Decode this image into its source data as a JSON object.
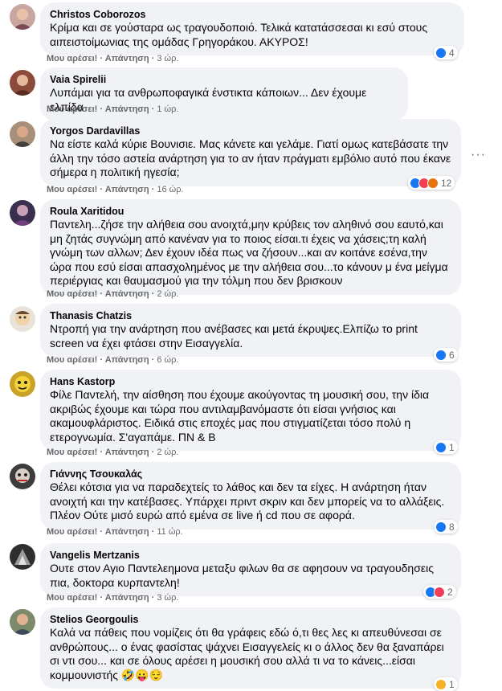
{
  "ui": {
    "like": "Μου αρέσει!",
    "reply": "Απάντηση",
    "dot": "·"
  },
  "colors": {
    "bubble": "#f0f2f5",
    "meta": "#65676b",
    "like_blue": "#1877f2",
    "heart_red": "#f33e58",
    "haha_yellow": "#f7b125"
  },
  "comments": [
    {
      "author": "Christos Coborozos",
      "text": "Κρίμα και σε γούσταρα ως τραγουδοποιό. Τελικά κατατάσσεσαι κι εσύ στους αιπειστοίμωνιας της ομάδας Γρηγοράκου. ΑΚΥΡΟΣ!",
      "time": "3 ώρ.",
      "reactions": [
        "like"
      ],
      "count": "4"
    },
    {
      "author": "Vaia Spirelii",
      "text": "Λυπάμαι για τα ανθρωποφαγικά ένστικτα κάποιων... Δεν έχουμε ελπίδα",
      "time": "1 ώρ.",
      "reactions": [],
      "count": ""
    },
    {
      "author": "Yorgos Dardavillas",
      "text": "Να είστε καλά κύριε Βουνισιε. Μας κάνετε και γελάμε. Γιατί ομως κατεβάσατε την άλλη την τόσο αστεία ανάρτηση για το αν ήταν πράγματι εμβόλιο αυτό που έκανε σήμερα η πολιτική ηγεσία;",
      "time": "16 ώρ.",
      "reactions": [
        "like",
        "love",
        "angry"
      ],
      "count": "12"
    },
    {
      "author": "Roula Xaritidou",
      "text": "Παντελη...ζήσε την αλήθεια σου ανοιχτά,μην κρύβεις τον αληθινό σου εαυτό,και μη ζητάς συγνώμη από κανέναν για το ποιος είσαι.τι έχεις να χάσεις;τη καλή γνώμη των αλλων; Δεν έχουν ιδέα πως να ζήσουν...και αν κοιτάνε εσένα,την ώρα που εσύ είσαι απασχολημένος με την αλήθεια σου...το κάνουν μ ένα μείγμα περιέργιας και θαυμασμού για την τόλμη που δεν βρισκουν",
      "time": "2 ώρ.",
      "reactions": [],
      "count": ""
    },
    {
      "author": "Thanasis Chatzis",
      "text": "Ντροπή για την ανάρτηση που ανέβασες και μετά έκρυψες.Ελπίζω το print screen να έχει φτάσει στην Εισαγγελία.",
      "time": "6 ώρ.",
      "reactions": [
        "like"
      ],
      "count": "6"
    },
    {
      "author": "Hans Kastorp",
      "text": "Φίλε Παντελή, την αίσθηση που έχουμε ακούγοντας τη μουσική σου, την ίδια ακριβώς έχουμε και τώρα που αντιλαμβανόμαστε ότι είσαι γνήσιος και ακαμουφλάριστος. Ειδικά στις εποχές μας που στιγματίζεται τόσο πολύ η ετερογνωμία. Σ'αγαπάμε. ΠΝ & Β",
      "time": "2 ώρ.",
      "reactions": [
        "like"
      ],
      "count": "1"
    },
    {
      "author": "Γιάννης Τσουκαλάς",
      "text": "Θέλει κότσια για να παραδεχτείς το λάθος και δεν τα είχες. Η ανάρτηση ήταν ανοιχτή και την κατέβασες. Υπάρχει πριντ σκριν και δεν μπορείς να το αλλάξεις. Πλέον Ούτε μισό ευρώ από εμένα σε live ή cd που σε αφορά.",
      "time": "11 ώρ.",
      "reactions": [
        "like"
      ],
      "count": "8"
    },
    {
      "author": "Vangelis Mertzanis",
      "text": "Ουτε στον Αγιο Παντελεημονα μεταξυ φιλων θα σε αφησουν να τραγουδησεις πια, δοκτορα κυρπαντελη!",
      "time": "3 ώρ.",
      "reactions": [
        "like",
        "love"
      ],
      "count": "2"
    },
    {
      "author": "Stelios Georgoulis",
      "text": "Καλά να πάθεις που νομίζεις ότι θα γράφεις εδώ ό,τι θες λες κι απευθύνεσαι σε ανθρώπους... ο ένας φασίστας ψάχνει Εισαγγελείς κι ο άλλος δεν θα ξαναπάρει σι ντι σου... και σε όλους αρέσει η μουσική σου αλλά τι να το κάνεις...είσαι κομμουνιστής 🤣😛😌",
      "time": "",
      "reactions": [
        "haha"
      ],
      "count": "1"
    }
  ]
}
